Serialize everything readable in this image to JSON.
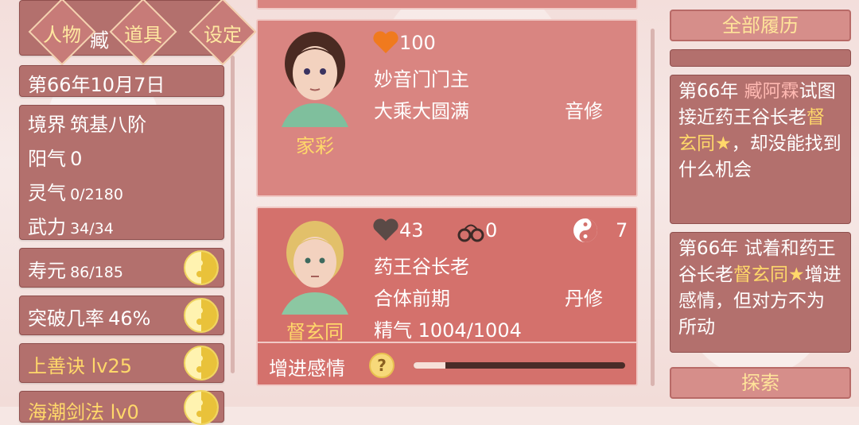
{
  "nav": {
    "person": "人物",
    "items": "道具",
    "settings": "设定",
    "partial_name": "臧"
  },
  "date": "第66年10月7日",
  "stats": {
    "realm_label": "境界",
    "realm_value": "筑基八阶",
    "yang_label": "阳气",
    "yang_value": "0",
    "spirit_label": "灵气",
    "spirit_value": "0/2180",
    "force_label": "武力",
    "force_value": "34/34"
  },
  "lifespan": {
    "label": "寿元",
    "value": "86/185"
  },
  "breakthrough": {
    "label": "突破几率",
    "value": "46%"
  },
  "skill1": "上善诀 lv25",
  "skill2": "海潮剑法 lv0",
  "card1": {
    "affection": "100",
    "title": "妙音门门主",
    "realm": "大乘大圆满",
    "type": "音修",
    "name": "家彩",
    "heart_color": "#f07a1e"
  },
  "card2": {
    "affection": "43",
    "shackles": "0",
    "yinyang": "7",
    "title": "药王谷长老",
    "realm": "合体前期",
    "type": "丹修",
    "essence": "精气 1004/1004",
    "name": "督玄同",
    "action": "增进感情",
    "progress": 0.15,
    "heart_color": "#5a4a46"
  },
  "right": {
    "history_btn": "全部履历",
    "log1": {
      "year": "第66年",
      "name": "臧阿霖",
      "text1": "试图接近药王谷长老",
      "target": "督玄同★",
      "text2": "，却没能找到什么机会"
    },
    "log2": {
      "year": "第66年",
      "text1": "试着和药王谷长老",
      "target": "督玄同★",
      "text2": "增进感情，但对方不为所动"
    },
    "explore_btn": "探索"
  }
}
